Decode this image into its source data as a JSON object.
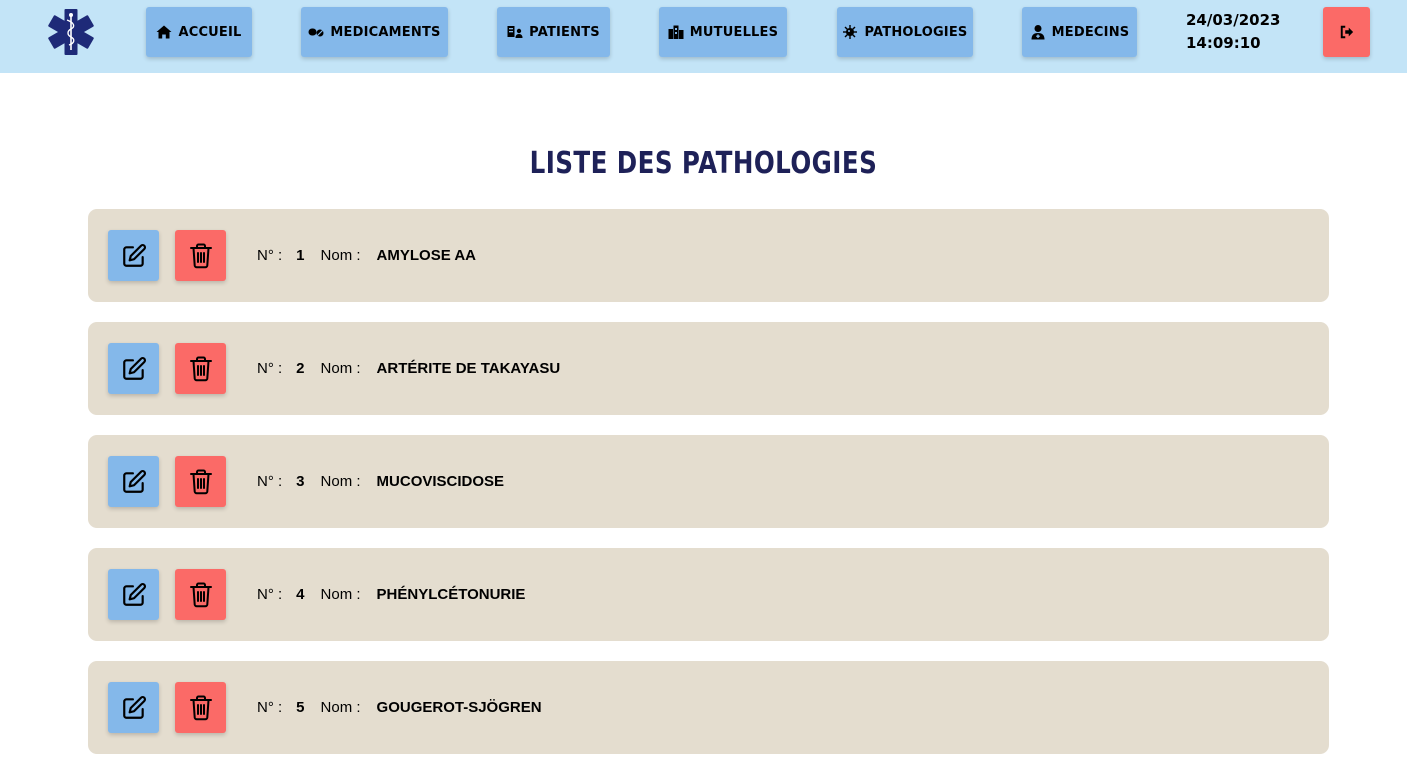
{
  "nav": {
    "items": [
      {
        "label": "ACCUEIL",
        "icon": "home-icon"
      },
      {
        "label": "MEDICAMENTS",
        "icon": "pills-icon"
      },
      {
        "label": "PATIENTS",
        "icon": "patients-icon"
      },
      {
        "label": "MUTUELLES",
        "icon": "buildings-icon"
      },
      {
        "label": "PATHOLOGIES",
        "icon": "virus-icon"
      },
      {
        "label": "MEDECINS",
        "icon": "doctor-icon"
      }
    ],
    "date": "24/03/2023",
    "time": "14:09:10",
    "logout_icon": "logout-icon"
  },
  "page": {
    "title": "LISTE DES PATHOLOGIES"
  },
  "labels": {
    "num": "N° :",
    "name": "Nom :"
  },
  "rows": [
    {
      "num": "1",
      "name": "AMYLOSE AA"
    },
    {
      "num": "2",
      "name": "ARTÉRITE DE TAKAYASU"
    },
    {
      "num": "3",
      "name": "MUCOVISCIDOSE"
    },
    {
      "num": "4",
      "name": "PHÉNYLCÉTONURIE"
    },
    {
      "num": "5",
      "name": "GOUGEROT-SJÖGREN"
    }
  ],
  "colors": {
    "navbar": "#c3e4f7",
    "nav_button": "#84b8ea",
    "danger": "#fb6a67",
    "row_background": "#e4ddcf",
    "title": "#1e2158",
    "logo": "#1e2a78"
  }
}
